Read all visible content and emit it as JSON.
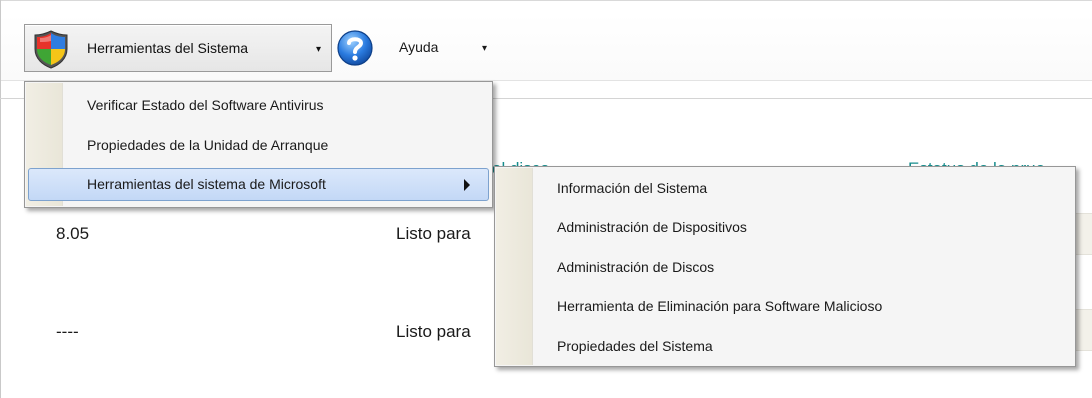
{
  "toolbar": {
    "system_tools_label": "Herramientas del Sistema",
    "help_label": "Ayuda",
    "dropdown_caret": "▾"
  },
  "table": {
    "column_disk": "el disco",
    "column_test_status": "Estatus de la prue",
    "rows": [
      {
        "value": "8.05",
        "status": "Listo para"
      },
      {
        "value": "----",
        "status": "Listo para"
      }
    ]
  },
  "system_menu": {
    "items": [
      {
        "label": "Verificar Estado del Software Antivirus"
      },
      {
        "label": "Propiedades de la Unidad de Arranque"
      },
      {
        "label": "Herramientas del sistema de Microsoft"
      }
    ]
  },
  "microsoft_submenu": {
    "items": [
      {
        "label": "Información del Sistema"
      },
      {
        "label": "Administración de Dispositivos"
      },
      {
        "label": "Administración de Discos"
      },
      {
        "label": "Herramienta de Eliminación para Software Malicioso"
      },
      {
        "label": "Propiedades del Sistema"
      }
    ]
  },
  "icons": {
    "shield": "windows-security-shield-icon",
    "help": "help-question-icon",
    "submenu_arrow": "submenu-arrow-icon"
  },
  "colors": {
    "teal_header": "#168c8c",
    "highlight": "#c3d8f6",
    "menu_bg": "#f5f5f5"
  }
}
